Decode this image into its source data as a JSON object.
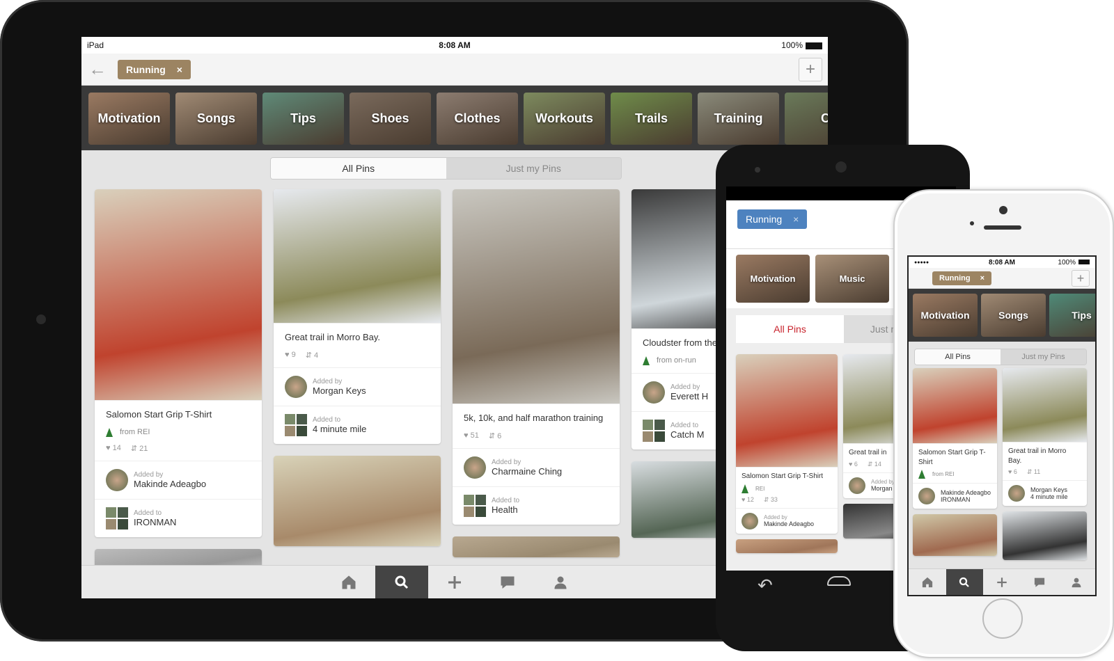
{
  "ipad": {
    "status": {
      "device": "iPad",
      "time": "8:08 AM",
      "battery": "100%"
    },
    "search_chip": "Running",
    "chip_close": "×",
    "add_label": "+",
    "categories": [
      {
        "label": "Motivation",
        "color": "#9a7a62"
      },
      {
        "label": "Songs",
        "color": "#a08a74"
      },
      {
        "label": "Tips",
        "color": "#5f8a78"
      },
      {
        "label": "Shoes",
        "color": "#7a6a5c"
      },
      {
        "label": "Clothes",
        "color": "#8c7c70"
      },
      {
        "label": "Workouts",
        "color": "#7d8a5e"
      },
      {
        "label": "Trails",
        "color": "#6f8c4a"
      },
      {
        "label": "Training",
        "color": "#8a8a7a"
      },
      {
        "label": "C",
        "color": "#6a7a5a"
      }
    ],
    "tabs": [
      {
        "label": "All Pins",
        "active": true
      },
      {
        "label": "Just my Pins",
        "active": false
      }
    ],
    "columns": [
      [
        {
          "img": [
            "#d9d0bc",
            "#c0432e"
          ],
          "title": "Salomon Start Grip T-Shirt",
          "source": "from REI",
          "likes": "14",
          "repins": "21",
          "added_by_label": "Added by",
          "added_by": "Makinde Adeagbo",
          "added_to_label": "Added to",
          "added_to": "IRONMAN"
        },
        {
          "img": [
            "#bbb",
            "#999"
          ]
        }
      ],
      [
        {
          "img": [
            "#e6e9ee",
            "#8c8a5a"
          ],
          "title": "Great trail in Morro Bay.",
          "likes": "9",
          "repins": "4",
          "added_by_label": "Added by",
          "added_by": "Morgan Keys",
          "added_to_label": "Added to",
          "added_to": "4 minute mile"
        },
        {
          "img": [
            "#d8d2b8",
            "#a88a6a"
          ]
        }
      ],
      [
        {
          "img": [
            "#c9c7c0",
            "#7a6a58"
          ],
          "title": "5k, 10k, and half marathon training",
          "likes": "51",
          "repins": "6",
          "added_by_label": "Added by",
          "added_by": "Charmaine Ching",
          "added_to_label": "Added to",
          "added_to": "Health"
        },
        {
          "img": [
            "#b8a890",
            "#9a8a70"
          ]
        }
      ],
      [
        {
          "img": [
            "#3a3a3a",
            "#cfd6da"
          ],
          "title": "Cloudster from these on the tra",
          "source": "from on-run",
          "added_by_label": "Added by",
          "added_by": "Everett H",
          "added_to_label": "Added to",
          "added_to": "Catch M"
        },
        {
          "img": [
            "#d8dde0",
            "#556655"
          ]
        }
      ]
    ],
    "bottom_tabs": [
      {
        "icon": "home-icon"
      },
      {
        "icon": "search-icon",
        "active": true
      },
      {
        "icon": "plus-icon"
      },
      {
        "icon": "chat-icon"
      },
      {
        "icon": "profile-icon"
      }
    ]
  },
  "android": {
    "search_chip": "Running",
    "chip_close": "×",
    "accent": "#c8232c",
    "categories": [
      {
        "label": "Motivation",
        "color": "#9a7a62"
      },
      {
        "label": "Music",
        "color": "#a89078"
      }
    ],
    "tabs": [
      {
        "label": "All Pins",
        "active": true
      },
      {
        "label": "Just my Pins",
        "active": false
      }
    ],
    "columns": [
      [
        {
          "img": [
            "#d9d0bc",
            "#c0432e"
          ],
          "title": "Salomon Start Grip T-Shirt",
          "source": "REI",
          "repins": "33",
          "likes": "12",
          "added_by_label": "Added by",
          "added_by": "Makinde Adeagbo"
        },
        {
          "img": [
            "#c8a080",
            "#a0765a"
          ]
        }
      ],
      [
        {
          "img": [
            "#e6e9ee",
            "#8c8a5a"
          ],
          "title": "Great trail in",
          "repins": "14",
          "likes": "6",
          "added_by_label": "Added by",
          "added_by": "Morgan Keys"
        },
        {
          "img": [
            "#333",
            "#888"
          ]
        }
      ]
    ]
  },
  "iphone": {
    "status": {
      "signal": "●●●●●",
      "time": "8:08 AM",
      "battery": "100%"
    },
    "search_chip": "Running",
    "chip_close": "×",
    "add_label": "+",
    "categories": [
      {
        "label": "Motivation",
        "color": "#9a7a62"
      },
      {
        "label": "Songs",
        "color": "#a08a74"
      },
      {
        "label": "Tips",
        "color": "#4f8a78"
      }
    ],
    "tabs": [
      {
        "label": "All Pins",
        "active": true
      },
      {
        "label": "Just my Pins",
        "active": false
      }
    ],
    "columns": [
      [
        {
          "img": [
            "#d9d0bc",
            "#c0432e"
          ],
          "title": "Salomon Start Grip T-Shirt",
          "source": "from REI",
          "added_by": "Makinde Adeagbo",
          "added_to": "IRONMAN"
        },
        {
          "img": [
            "#d0c8a8",
            "#a06a50"
          ]
        }
      ],
      [
        {
          "img": [
            "#e6e9ee",
            "#8c8a5a"
          ],
          "title": "Great trail in Morro Bay.",
          "repins": "11",
          "likes": "6",
          "added_by": "Morgan Keys",
          "added_to": "4 minute mile"
        },
        {
          "img": [
            "#dfe3e6",
            "#333"
          ]
        }
      ]
    ],
    "bottom_tabs": [
      {
        "icon": "home-icon"
      },
      {
        "icon": "search-icon",
        "active": true
      },
      {
        "icon": "plus-icon"
      },
      {
        "icon": "chat-icon"
      },
      {
        "icon": "profile-icon"
      }
    ]
  }
}
